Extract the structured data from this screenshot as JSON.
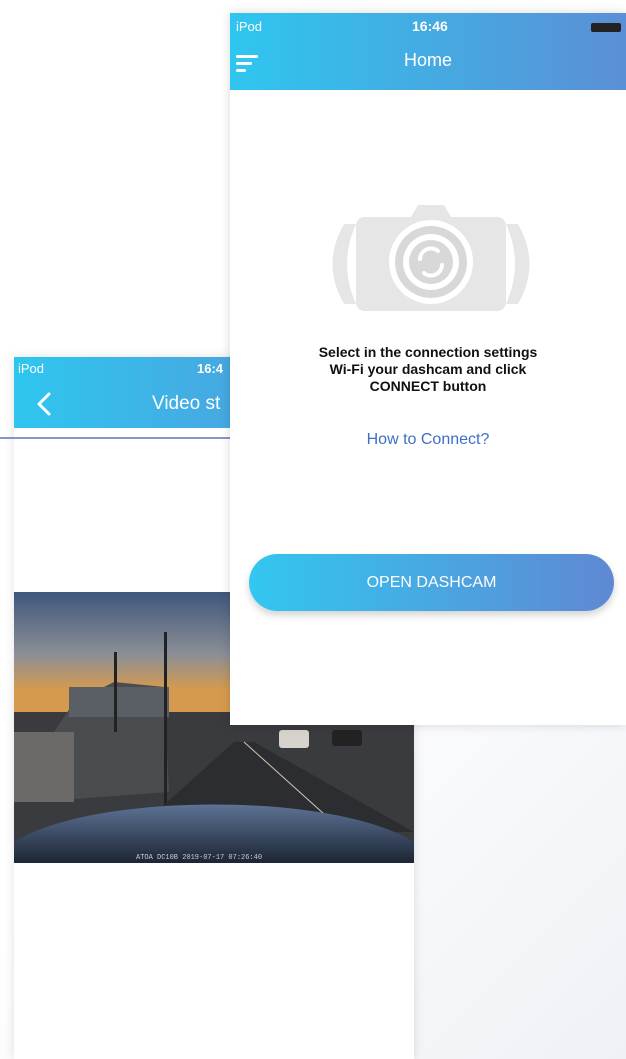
{
  "back_screen": {
    "status": {
      "carrier": "iPod",
      "time": "16:4"
    },
    "header": {
      "title": "Video st"
    },
    "video": {
      "overlay_text": "ATOA DC10B  2019-07-17 07:26:40"
    }
  },
  "front_screen": {
    "status": {
      "carrier": "iPod",
      "time": "16:46"
    },
    "header": {
      "title": "Home"
    },
    "instructions": [
      "Select in the connection settings",
      "Wi-Fi your dashcam and click",
      "CONNECT button"
    ],
    "how_to_link": "How to Connect?",
    "open_button": "OPEN DASHCAM"
  },
  "colors": {
    "header_start": "#2ec6ef",
    "header_end": "#5b8fd6",
    "link": "#3d6fc4",
    "connector": "#5b73b8"
  }
}
